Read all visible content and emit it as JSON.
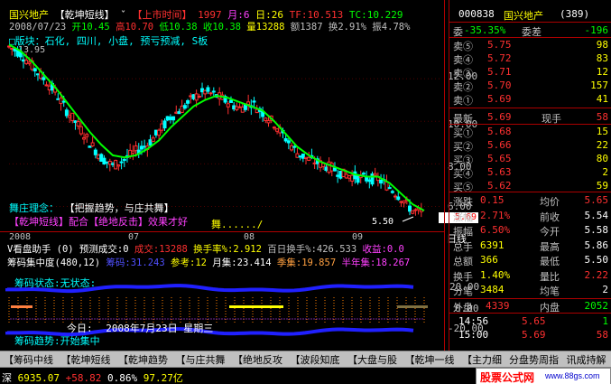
{
  "header": {
    "stock_name": "国兴地产",
    "formula_name": "【乾坤短线】",
    "menu_arrow": "ˇ",
    "listing_label": "【上市时间】",
    "listing_year": "1997",
    "listing_month": "月:6",
    "listing_day": "日:26",
    "tf_label": "TF:10.513",
    "tc_label": "TC:10.229",
    "date_line": "2008/07/23",
    "open_label": "开10.45",
    "high_label": "高10.70",
    "low_label": "低10.38",
    "close_label": "收10.38",
    "volume_label": "量13288",
    "amount_label": "额1387",
    "turnover_label": "换2.91%",
    "amplitude_label": "振4.78%",
    "sector_label": "□版块：石化, 四川, 小盘, 预亏预减, S板",
    "peak_label": "13.95"
  },
  "annotations": {
    "idea_label": "舞庄理念：",
    "idea_text": "【把握趋势，与庄共舞】",
    "combo_text": "【乾坤短线】配合【绝地反击】效果才好",
    "dance_text": "舞....../",
    "low_label": "5.50",
    "current_price_tag": "5.69"
  },
  "axis": {
    "price_ticks": [
      "12.00",
      "10.00",
      "8.00",
      "6.00"
    ],
    "dates": [
      "2008",
      "07",
      "08",
      "09"
    ],
    "period_label": "日线",
    "chip_ticks": [
      "20.00",
      "0.00",
      "-20.00"
    ]
  },
  "volume_bar": {
    "title": "V看盘助手 (0) 预测成交:0",
    "success_label": "成交:13288",
    "turnover_rate": "换手率%:2.912",
    "hundred_day": "百日换手%:426.533",
    "profit_label": "收益:0.0"
  },
  "chip_bar": {
    "title": "筹码集中度(480,12)",
    "chip_label": "筹码:31.243",
    "ref_label": "参考:12",
    "month_label": "月集:23.414",
    "season_label": "季集:19.857",
    "half_year_label": "半年集:18.267",
    "status_label": "筹码状态:无状态:",
    "today_label": "今日:",
    "today_date": "2008年7月23日 星期三",
    "trend_label": "筹码趋势:开始集中"
  },
  "quote": {
    "code": "000838",
    "name": "国兴地产",
    "rank": "(389)",
    "wei_bi_label": "委",
    "wei_bi_value": "-35.35%",
    "wei_cha_label": "委差",
    "wei_cha_value": "-196",
    "sells": [
      {
        "label": "卖⑤",
        "price": "5.75",
        "vol": "98"
      },
      {
        "label": "卖④",
        "price": "5.72",
        "vol": "83"
      },
      {
        "label": "卖③",
        "price": "5.71",
        "vol": "12"
      },
      {
        "label": "卖②",
        "price": "5.70",
        "vol": "157"
      },
      {
        "label": "卖①",
        "price": "5.69",
        "vol": "41"
      }
    ],
    "latest_label": "最新",
    "latest_price": "5.69",
    "current_hand_label": "现手",
    "current_hand": "58",
    "buys": [
      {
        "label": "买①",
        "price": "5.68",
        "vol": "15"
      },
      {
        "label": "买②",
        "price": "5.66",
        "vol": "22"
      },
      {
        "label": "买③",
        "price": "5.65",
        "vol": "80"
      },
      {
        "label": "买④",
        "price": "5.63",
        "vol": "2"
      },
      {
        "label": "买⑤",
        "price": "5.62",
        "vol": "59"
      }
    ],
    "stats": [
      {
        "l1": "涨跌",
        "v1": "0.15",
        "l2": "均价",
        "v2": "5.65"
      },
      {
        "l1": "涨幅",
        "v1": "2.71%",
        "l2": "前收",
        "v2": "5.54"
      },
      {
        "l1": "振幅",
        "v1": "6.50%",
        "l2": "今开",
        "v2": "5.58"
      },
      {
        "l1": "总手",
        "v1": "6391",
        "l2": "最高",
        "v2": "5.86"
      },
      {
        "l1": "总额",
        "v1": "366",
        "l2": "最低",
        "v2": "5.50"
      },
      {
        "l1": "换手",
        "v1": "1.40%",
        "l2": "量比",
        "v2": "2.22"
      },
      {
        "l1": "分笔",
        "v1": "3484",
        "l2": "均笔",
        "v2": "2"
      }
    ],
    "outer_label": "外盘",
    "outer_value": "4339",
    "inner_label": "内盘",
    "inner_value": "2052",
    "ticks": [
      {
        "time": "14:56",
        "price": "5.65",
        "vol": "1"
      },
      {
        "time": "15:00",
        "price": "5.69",
        "vol": "58"
      }
    ]
  },
  "tabs": [
    "【筹码中线",
    "【乾坤短线",
    "【乾坤趋势",
    "【与庄共舞",
    "【绝地反攻",
    "【波段知底",
    "【大盘与股",
    "【乾坤一线",
    "【主力细",
    "分盘势周指",
    "讯成持解"
  ],
  "status": {
    "index_name": "深",
    "index_value": "6935.07",
    "index_change": "+58.82",
    "index_pct": "0.86%",
    "index_amount": "97.27亿",
    "watermark": "股票公式网",
    "watermark_url": "www.88gs.com"
  },
  "chart_data": {
    "type": "candlestick",
    "x": [
      "2008",
      "07",
      "08",
      "09"
    ],
    "ylim": [
      5.0,
      14.0
    ],
    "peak": 13.95,
    "trough": 5.5,
    "last": 5.69,
    "close_trend": [
      13.5,
      13.2,
      12.6,
      12.0,
      11.4,
      10.5,
      9.8,
      9.0,
      8.3,
      7.9,
      8.2,
      8.6,
      8.9,
      9.5,
      10.2,
      10.6,
      11.1,
      11.4,
      11.2,
      10.9,
      10.6,
      10.9,
      10.4,
      9.9,
      9.2,
      8.5,
      8.2,
      8.0,
      7.8,
      7.5,
      7.4,
      7.3,
      7.3,
      6.9,
      6.4,
      5.8,
      5.69
    ],
    "ma_line": [
      13.6,
      13.3,
      12.8,
      12.2,
      11.6,
      10.9,
      10.2,
      9.5,
      8.9,
      8.4,
      8.3,
      8.4,
      8.7,
      9.1,
      9.7,
      10.2,
      10.7,
      11.0,
      11.2,
      11.1,
      10.9,
      10.7,
      10.5,
      10.0,
      9.4,
      8.8,
      8.4,
      8.1,
      7.9,
      7.7,
      7.5,
      7.4,
      7.4,
      7.1,
      6.6,
      6.1,
      5.8
    ]
  }
}
